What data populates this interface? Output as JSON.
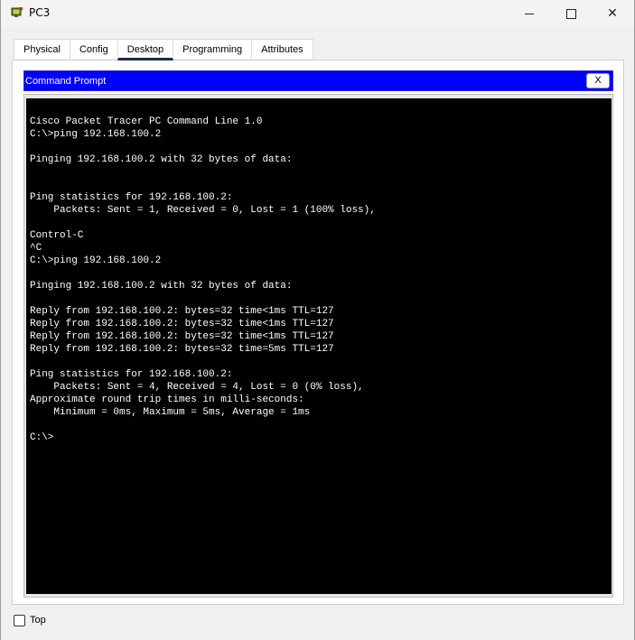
{
  "window": {
    "title": "PC3",
    "minimize_icon": "minimize-icon",
    "maximize_icon": "maximize-icon",
    "close_glyph": "✕"
  },
  "tabs": [
    {
      "label": "Physical"
    },
    {
      "label": "Config"
    },
    {
      "label": "Desktop",
      "active": true
    },
    {
      "label": "Programming"
    },
    {
      "label": "Attributes"
    }
  ],
  "command_prompt": {
    "title": "Command Prompt",
    "close_label": "X",
    "accent_color": "#0000ff",
    "output": "Cisco Packet Tracer PC Command Line 1.0\nC:\\>ping 192.168.100.2\n\nPinging 192.168.100.2 with 32 bytes of data:\n\n\nPing statistics for 192.168.100.2:\n    Packets: Sent = 1, Received = 0, Lost = 1 (100% loss),\n\nControl-C\n^C\nC:\\>ping 192.168.100.2\n\nPinging 192.168.100.2 with 32 bytes of data:\n\nReply from 192.168.100.2: bytes=32 time<1ms TTL=127\nReply from 192.168.100.2: bytes=32 time<1ms TTL=127\nReply from 192.168.100.2: bytes=32 time<1ms TTL=127\nReply from 192.168.100.2: bytes=32 time=5ms TTL=127\n\nPing statistics for 192.168.100.2:\n    Packets: Sent = 4, Received = 4, Lost = 0 (0% loss),\nApproximate round trip times in milli-seconds:\n    Minimum = 0ms, Maximum = 5ms, Average = 1ms\n\nC:\\>"
  },
  "footer": {
    "top_label": "Top",
    "top_checked": false
  }
}
